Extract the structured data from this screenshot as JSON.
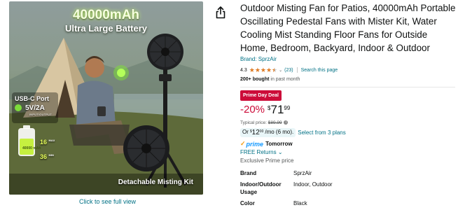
{
  "image": {
    "headline": "40000mAh",
    "subheadline": "Ultra Large Battery",
    "usb_title": "USB-C Port",
    "usb_value": "5V/2A",
    "usb_sub": "INPUT/OUTPUT",
    "battery_cell_text": "40000 mAh",
    "battery_stat_1": "16",
    "battery_stat_1_unit": "MAX",
    "battery_stat_2": "36",
    "battery_stat_2_unit": "MIN",
    "bottom_caption": "Detachable Misting Kit",
    "see_full_link": "Click to see full view"
  },
  "product": {
    "title": "Outdoor Misting Fan for Patios, 40000mAh Portable Oscillating Pedestal Fans with Mister Kit, Water Cooling Mist Standing Floor Fans for Outside Home, Bedroom, Backyard, Indoor & Outdoor",
    "brand_link": "Brand: SprzAir",
    "rating_value": "4.3",
    "rating_stars": 4.3,
    "rating_count": "(23)",
    "search_page_link": "Search this page",
    "bought_bold": "200+ bought",
    "bought_rest": " in past month",
    "deal_badge": "Prime Day Deal",
    "discount": "-20%",
    "price_symbol": "$",
    "price_whole": "71",
    "price_fraction": "99",
    "typical_label": "Typical price: ",
    "typical_price": "$89.99",
    "plan_or": "Or",
    "plan_symbol": "$",
    "plan_whole": "12",
    "plan_fraction": "00",
    "plan_term": "/mo (6 mo).",
    "plan_link": "Select from 3 plans",
    "prime_label": "prime",
    "prime_delivery": "Tomorrow",
    "returns_link": "FREE Returns",
    "exclusive_text": "Exclusive Prime price"
  },
  "specs": [
    {
      "key": "Brand",
      "value": "SprzAir"
    },
    {
      "key": "Indoor/Outdoor Usage",
      "value": "Indoor, Outdoor"
    },
    {
      "key": "Color",
      "value": "Black"
    }
  ],
  "colors": {
    "link": "#007185",
    "deal_red": "#cc0c39",
    "star": "#de7921",
    "prime_blue": "#1399ff"
  }
}
